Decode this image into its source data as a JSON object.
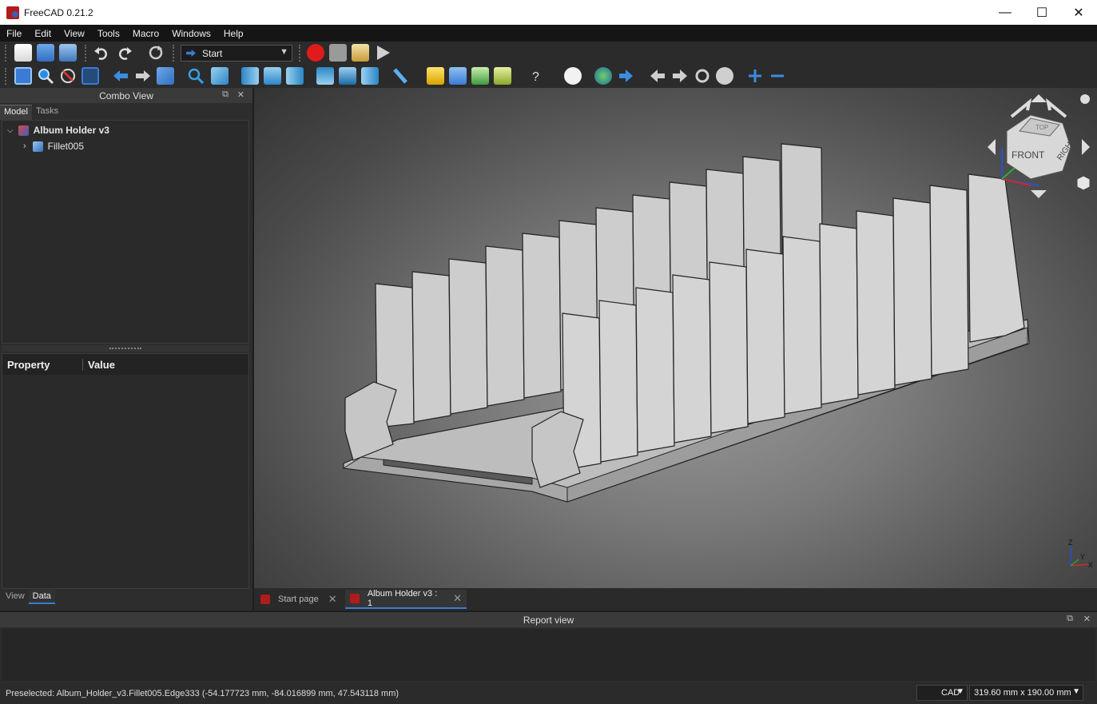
{
  "window": {
    "title": "FreeCAD 0.21.2",
    "minimize": "—",
    "maximize": "☐",
    "close": "✕"
  },
  "menu": [
    "File",
    "Edit",
    "View",
    "Tools",
    "Macro",
    "Windows",
    "Help"
  ],
  "workbench": {
    "selected": "Start"
  },
  "combo_view": {
    "title": "Combo View",
    "tabs": [
      "Model",
      "Tasks"
    ],
    "tree": [
      {
        "label": "Album Holder v3",
        "expanded": true
      },
      {
        "label": "Fillet005",
        "expanded": false
      }
    ],
    "property_header": {
      "property": "Property",
      "value": "Value"
    },
    "bottom_tabs": [
      "View",
      "Data"
    ]
  },
  "nav_cube": {
    "top": "TOP",
    "front": "FRONT",
    "right": "RIGHT"
  },
  "axis": {
    "z": "Z",
    "y": "Y",
    "x": "X"
  },
  "doc_tabs": [
    {
      "label": "Start page",
      "active": false
    },
    {
      "label": "Album Holder v3 : 1",
      "active": true
    }
  ],
  "report_view": {
    "title": "Report view"
  },
  "status": {
    "message": "Preselected: Album_Holder_v3.Fillet005.Edge333 (-54.177723 mm, -84.016899 mm, 47.543118 mm)",
    "navigation_style": "CAD",
    "dimensions": "319.60 mm x 190.00 mm"
  },
  "colors": {
    "accent": "#3a7bd5",
    "record": "#e01b1b",
    "model": "#c8c8c8"
  }
}
